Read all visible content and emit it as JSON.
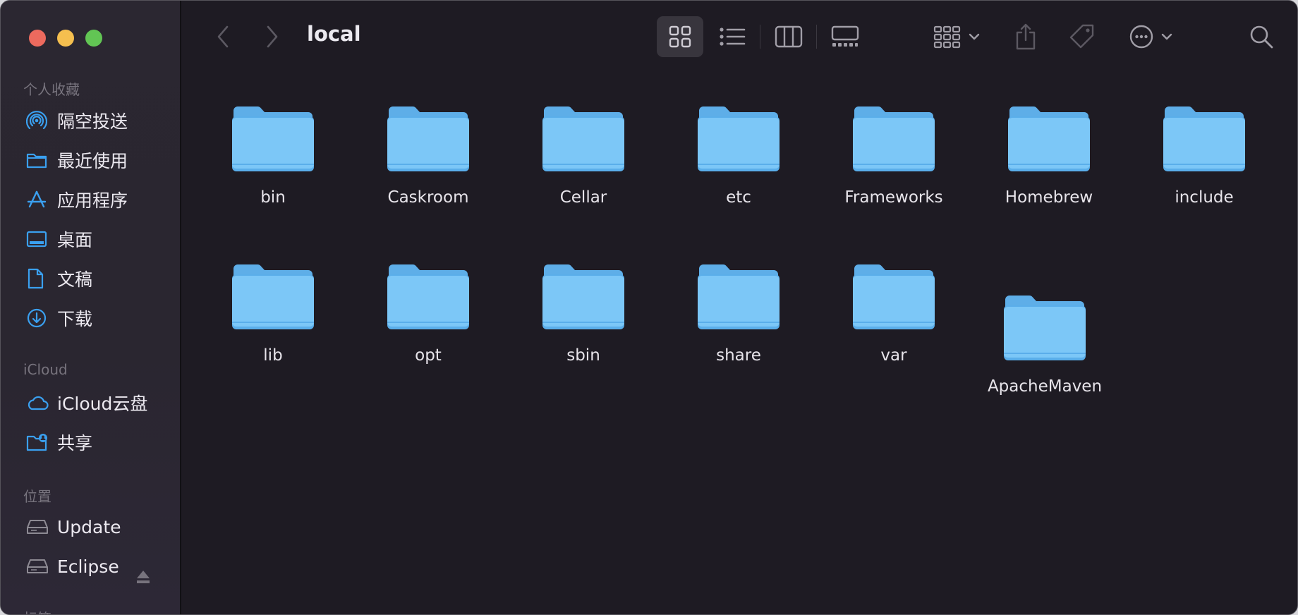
{
  "window": {
    "title": "local"
  },
  "sidebar": {
    "favorites_header": "个人收藏",
    "favorites": [
      {
        "label": "隔空投送",
        "icon": "airdrop-icon"
      },
      {
        "label": "最近使用",
        "icon": "folder-recents-icon"
      },
      {
        "label": "应用程序",
        "icon": "applications-icon"
      },
      {
        "label": "桌面",
        "icon": "desktop-icon"
      },
      {
        "label": "文稿",
        "icon": "document-icon"
      },
      {
        "label": "下载",
        "icon": "download-icon"
      }
    ],
    "icloud_header": "iCloud",
    "icloud": [
      {
        "label": "iCloud云盘",
        "icon": "cloud-icon"
      },
      {
        "label": "共享",
        "icon": "shared-folder-icon"
      }
    ],
    "locations_header": "位置",
    "locations": [
      {
        "label": "Update",
        "icon": "disk-icon"
      },
      {
        "label": "Eclipse",
        "icon": "disk-icon"
      }
    ],
    "tags_header": "标签"
  },
  "toolbar": {
    "icons": [
      "back-icon",
      "forward-icon",
      "icon-view-icon",
      "list-view-icon",
      "column-view-icon",
      "gallery-view-icon",
      "group-icon",
      "share-icon",
      "tag-icon",
      "more-icon",
      "search-icon"
    ]
  },
  "folders": [
    "bin",
    "Caskroom",
    "Cellar",
    "etc",
    "Frameworks",
    "Homebrew",
    "include",
    "lib",
    "opt",
    "sbin",
    "share",
    "var",
    "ApacheMaven"
  ],
  "colors": {
    "folder_body": "#7cc7f7",
    "folder_tab": "#5eaee8",
    "sidebar_icon": "#3aa0f0",
    "close": "#ed6a5e",
    "minimize": "#f5bf4f",
    "maximize": "#62c554"
  }
}
